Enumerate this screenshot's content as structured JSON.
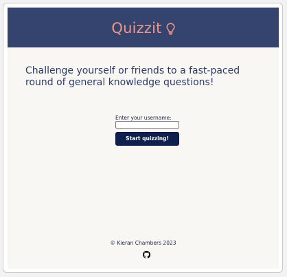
{
  "header": {
    "brand": "Quizzit",
    "brand_icon": "lightbulb-icon",
    "background_color": "#35436f",
    "brand_color": "#f59584"
  },
  "main": {
    "intro": "Challenge yourself or friends to a fast-paced round of general knowledge questions!",
    "username_label": "Enter your username:",
    "username_value": "",
    "start_button_label": "Start quizzing!",
    "button_color": "#10204d",
    "page_background": "#f9f7f4"
  },
  "footer": {
    "copyright": "© Kieran Chambers 2023",
    "link_icon": "github-icon"
  }
}
